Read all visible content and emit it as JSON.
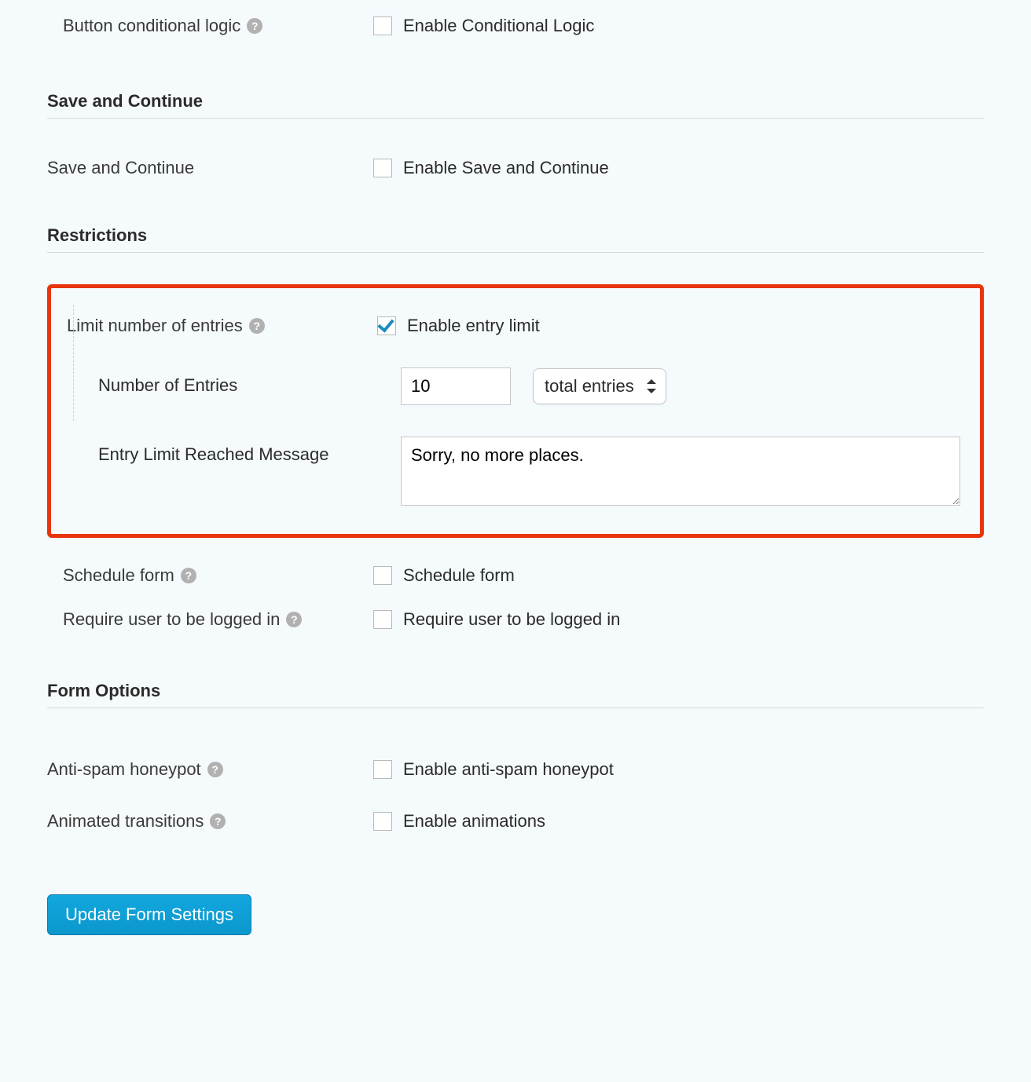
{
  "button_logic": {
    "label": "Button conditional logic",
    "checkbox_label": "Enable Conditional Logic"
  },
  "save_continue": {
    "heading": "Save and Continue",
    "label": "Save and Continue",
    "checkbox_label": "Enable Save and Continue"
  },
  "restrictions": {
    "heading": "Restrictions",
    "limit_entries": {
      "label": "Limit number of entries",
      "checkbox_label": "Enable entry limit",
      "num_label": "Number of Entries",
      "num_value": "10",
      "select_value": "total entries",
      "msg_label": "Entry Limit Reached Message",
      "msg_value": "Sorry, no more places."
    },
    "schedule_form": {
      "label": "Schedule form",
      "checkbox_label": "Schedule form"
    },
    "require_login": {
      "label": "Require user to be logged in",
      "checkbox_label": "Require user to be logged in"
    }
  },
  "form_options": {
    "heading": "Form Options",
    "honeypot": {
      "label": "Anti-spam honeypot",
      "checkbox_label": "Enable anti-spam honeypot"
    },
    "animated": {
      "label": "Animated transitions",
      "checkbox_label": "Enable animations"
    }
  },
  "submit_label": "Update Form Settings"
}
